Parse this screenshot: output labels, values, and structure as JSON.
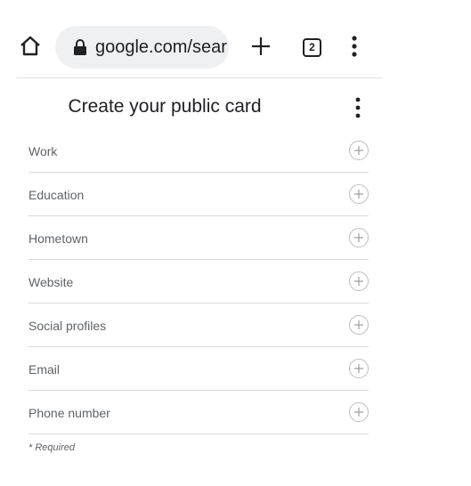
{
  "browser": {
    "url": "google.com/sear",
    "tab_count": "2",
    "icons": {
      "home": "home-icon",
      "lock": "lock-icon",
      "new_tab": "plus-icon",
      "menu": "more-vert-icon"
    }
  },
  "card": {
    "title": "Create your public card",
    "fields": [
      {
        "label": "Work"
      },
      {
        "label": "Education"
      },
      {
        "label": "Hometown"
      },
      {
        "label": "Website"
      },
      {
        "label": "Social profiles"
      },
      {
        "label": "Email"
      },
      {
        "label": "Phone number"
      }
    ],
    "required_note": "* Required"
  },
  "colors": {
    "text_primary": "#202124",
    "text_secondary": "#5f6368",
    "url_pill_bg": "#eef0f2",
    "divider": "#d8d8d8",
    "add_button_border": "#bdbdbd"
  }
}
